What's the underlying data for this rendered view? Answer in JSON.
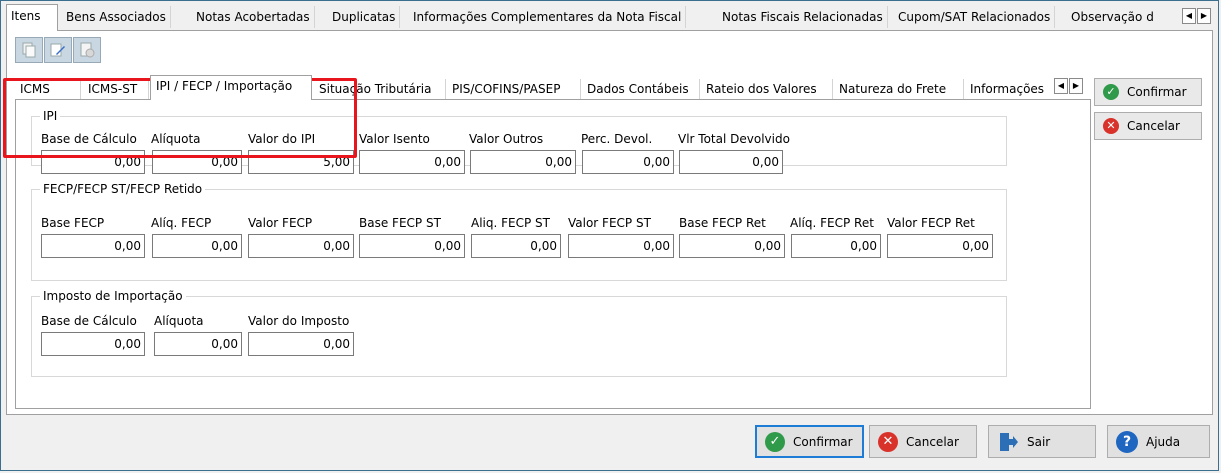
{
  "top_tabs": [
    {
      "label": "Itens"
    },
    {
      "label": "Bens Associados"
    },
    {
      "label": "Notas Acobertadas"
    },
    {
      "label": "Duplicatas"
    },
    {
      "label": "Informações Complementares da Nota Fiscal"
    },
    {
      "label": "Notas Fiscais Relacionadas"
    },
    {
      "label": "Cupom/SAT Relacionados"
    },
    {
      "label": "Observação d"
    }
  ],
  "inner_tabs": [
    {
      "label": "ICMS"
    },
    {
      "label": "ICMS-ST"
    },
    {
      "label": "IPI / FECP / Importação"
    },
    {
      "label": "Situação Tributária"
    },
    {
      "label": "PIS/COFINS/PASEP"
    },
    {
      "label": "Dados Contábeis"
    },
    {
      "label": "Rateio dos Valores"
    },
    {
      "label": "Natureza do Frete"
    },
    {
      "label": "Informações"
    }
  ],
  "ipi": {
    "title": "IPI",
    "fields": [
      {
        "label": "Base de Cálculo",
        "value": "0,00"
      },
      {
        "label": "Alíquota",
        "value": "0,00"
      },
      {
        "label": "Valor do IPI",
        "value": "5,00"
      },
      {
        "label": "Valor Isento",
        "value": "0,00"
      },
      {
        "label": "Valor Outros",
        "value": "0,00"
      },
      {
        "label": "Perc. Devol.",
        "value": "0,00"
      },
      {
        "label": "Vlr Total Devolvido",
        "value": "0,00"
      }
    ]
  },
  "fecp": {
    "title": "FECP/FECP ST/FECP Retido",
    "fields": [
      {
        "label": "Base FECP",
        "value": "0,00"
      },
      {
        "label": "Alíq. FECP",
        "value": "0,00"
      },
      {
        "label": "Valor FECP",
        "value": "0,00"
      },
      {
        "label": "Base FECP ST",
        "value": "0,00"
      },
      {
        "label": "Aliq. FECP ST",
        "value": "0,00"
      },
      {
        "label": "Valor FECP ST",
        "value": "0,00"
      },
      {
        "label": "Base FECP Ret",
        "value": "0,00"
      },
      {
        "label": "Alíq. FECP Ret",
        "value": "0,00"
      },
      {
        "label": "Valor FECP Ret",
        "value": "0,00"
      }
    ]
  },
  "importacao": {
    "title": "Imposto de Importação",
    "fields": [
      {
        "label": "Base de Cálculo",
        "value": "0,00"
      },
      {
        "label": "Alíquota",
        "value": "0,00"
      },
      {
        "label": "Valor do Imposto",
        "value": "0,00"
      }
    ]
  },
  "side_buttons": {
    "confirm": "Confirmar",
    "cancel": "Cancelar"
  },
  "bottom_buttons": {
    "confirm": "Confirmar",
    "cancel": "Cancelar",
    "exit": "Sair",
    "help": "Ajuda"
  },
  "colors": {
    "highlight": "#e8161c",
    "confirm_green": "#2f9a4a",
    "cancel_red": "#d9322b",
    "help_blue": "#1f66c1",
    "focus_border": "#1d7dd6"
  }
}
